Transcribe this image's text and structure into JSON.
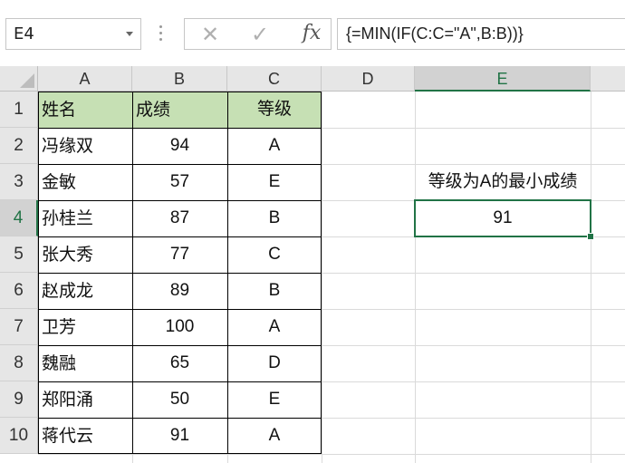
{
  "formula_bar": {
    "name_box": "E4",
    "formula": "{=MIN(IF(C:C=\"A\",B:B))}",
    "cancel_icon": "✕",
    "enter_icon": "✓",
    "fx_label": "fx"
  },
  "columns": [
    "A",
    "B",
    "C",
    "D",
    "E"
  ],
  "rows": [
    "1",
    "2",
    "3",
    "4",
    "5",
    "6",
    "7",
    "8",
    "9",
    "10"
  ],
  "table": {
    "headers": [
      "姓名",
      "成绩",
      "等级"
    ],
    "records": [
      {
        "name": "冯缘双",
        "score": "94",
        "grade": "A"
      },
      {
        "name": "金敏",
        "score": "57",
        "grade": "E"
      },
      {
        "name": "孙桂兰",
        "score": "87",
        "grade": "B"
      },
      {
        "name": "张大秀",
        "score": "77",
        "grade": "C"
      },
      {
        "name": "赵成龙",
        "score": "89",
        "grade": "B"
      },
      {
        "name": "卫芳",
        "score": "100",
        "grade": "A"
      },
      {
        "name": "魏融",
        "score": "65",
        "grade": "D"
      },
      {
        "name": "郑阳涌",
        "score": "50",
        "grade": "E"
      },
      {
        "name": "蒋代云",
        "score": "91",
        "grade": "A"
      }
    ]
  },
  "result": {
    "label": "等级为A的最小成绩",
    "value": "91"
  },
  "colors": {
    "accent": "#217346",
    "header_fill": "#c6e0b4"
  }
}
